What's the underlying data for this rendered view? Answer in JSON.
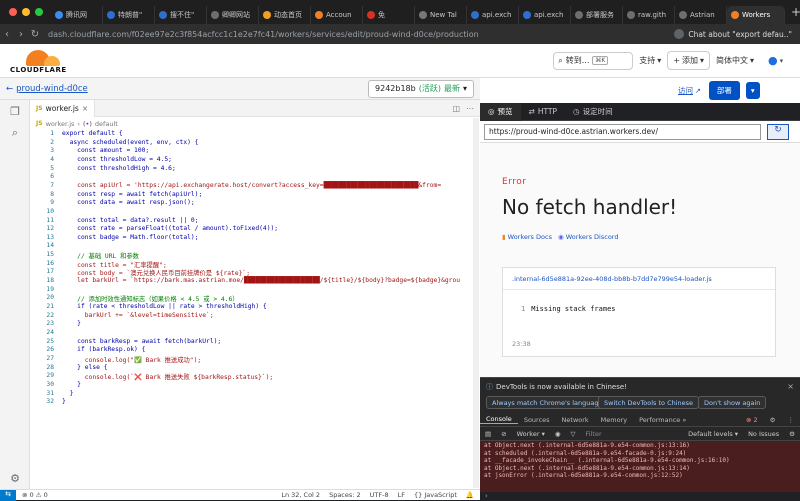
{
  "browser": {
    "tabs": [
      {
        "title": "腾讯网",
        "color": "#3c8cf5"
      },
      {
        "title": "特朗普\"",
        "color": "#2f6fcc"
      },
      {
        "title": "搜不住\"",
        "color": "#2f6fcc"
      },
      {
        "title": "卿卿网站",
        "color": "#6e6e6e"
      },
      {
        "title": "动态首页",
        "color": "#f0a020"
      },
      {
        "title": "Accoun",
        "color": "#f38020"
      },
      {
        "title": "免",
        "color": "#d93025"
      },
      {
        "title": "New Tal",
        "color": "#777777"
      },
      {
        "title": "api.exch",
        "color": "#2f6fcc"
      },
      {
        "title": "api.exch",
        "color": "#2f6fcc"
      },
      {
        "title": "部署服务",
        "color": "#6e6e6e"
      },
      {
        "title": "raw.gith",
        "color": "#6e6e6e"
      },
      {
        "title": "Astrian",
        "color": "#6e6e6e"
      },
      {
        "title": "Workers",
        "color": "#f38020"
      }
    ],
    "url": "dash.cloudflare.com/f02ee97e2c3f854acfcc1c1e2e7fc41/workers/services/edit/proud-wind-d0ce/production",
    "chat_label": "Chat about \"export defau..\""
  },
  "cf_header": {
    "logo_text": "CLOUDFLARE",
    "search_label": "转到...",
    "search_kbd": "⌘K",
    "support": "支持",
    "add": "添加",
    "language": "简体中文"
  },
  "editor": {
    "project": "proud-wind-d0ce",
    "version": "9242b18b",
    "version_status": "(活跃)",
    "version_tag": "最新",
    "file_tab": "worker.js",
    "breadcrumb_file": "worker.js",
    "breadcrumb_symbol": "default",
    "lines": [
      "export default {",
      "  async scheduled(event, env, ctx) {",
      "    const amount = 100;",
      "    const thresholdLow = 4.5;",
      "    const thresholdHigh = 4.6;",
      "",
      "    const apiUrl = 'https://api.exchangerate.host/convert?access_key=█████████████████████████&from=",
      "    const resp = await fetch(apiUrl);",
      "    const data = await resp.json();",
      "",
      "    const total = data?.result || 0;",
      "    const rate = parseFloat((total / amount).toFixed(4));",
      "    const badge = Math.floor(total);",
      "",
      "    // 基础 URL 和参数",
      "    const title = \"汇率提醒\";",
      "    const body = `澳元兑换人民币目前挂牌价是 ${rate}`;",
      "    let barkUrl = `https://bark.mas.astrian.moe/████████████████████/${title}/${body}?badge=${badge}&grou",
      "",
      "    // 添加时效性通知标志（如果价格 < 4.5 或 > 4.6）",
      "    if (rate < thresholdLow || rate > thresholdHigh) {",
      "      barkUrl += `&level=timeSensitive`;",
      "    }",
      "",
      "    const barkResp = await fetch(barkUrl);",
      "    if (barkResp.ok) {",
      "      console.log(\"✅ Bark 推送成功\");",
      "    } else {",
      "      console.log(`❌ Bark 推送失败 ${barkResp.status}`);",
      "    }",
      "  }",
      "}"
    ],
    "status": {
      "errors": "⊗ 0 ⚠ 0",
      "position": "Ln 32, Col 2",
      "spaces": "Spaces: 2",
      "encoding": "UTF-8",
      "eol": "LF",
      "language": "{} JavaScript"
    }
  },
  "panel": {
    "visit": "访问",
    "deploy": "部署",
    "tabs": [
      "预览",
      "HTTP",
      "设定时间"
    ],
    "preview_url": "https://proud-wind-d0ce.astrian.workers.dev/",
    "error_label": "Error",
    "error_title": "No fetch handler!",
    "link_docs": "Workers Docs",
    "link_discord": "Workers Discord",
    "card_file": ".internal-6d5e881a-92ee-408d-bb8b-b7dd7e799e54-loader.js",
    "card_line_num": "1",
    "card_line": "Missing stack frames",
    "card_time": "23:38"
  },
  "devtools": {
    "notice": "DevTools is now available in Chinese!",
    "btn_match": "Always match Chrome's language",
    "btn_switch": "Switch DevTools to Chinese",
    "btn_dont": "Don't show again",
    "tabs": [
      "Console",
      "Sources",
      "Network",
      "Memory",
      "Performance »"
    ],
    "error_count": "⊗ 2",
    "context": "Worker ▾",
    "filter": "Filter",
    "levels": "Default levels ▾",
    "issues": "No Issues",
    "console_lines": [
      "    at Object.next (.internal-6d5e881a-9.e54-common.js:13:16)",
      "    at scheduled (.internal-6d5e881a-9.e54-facade-0.js:9:24)",
      "    at __facade_invokeChain__ (.internal-6d5e881a-9.e54-common.js:16:10)",
      "    at Object.next (.internal-6d5e881a-9.e54-common.js:13:14)",
      "    at jsonError (.internal-6d5e881a-9.e54-common.js:12:52)"
    ]
  }
}
